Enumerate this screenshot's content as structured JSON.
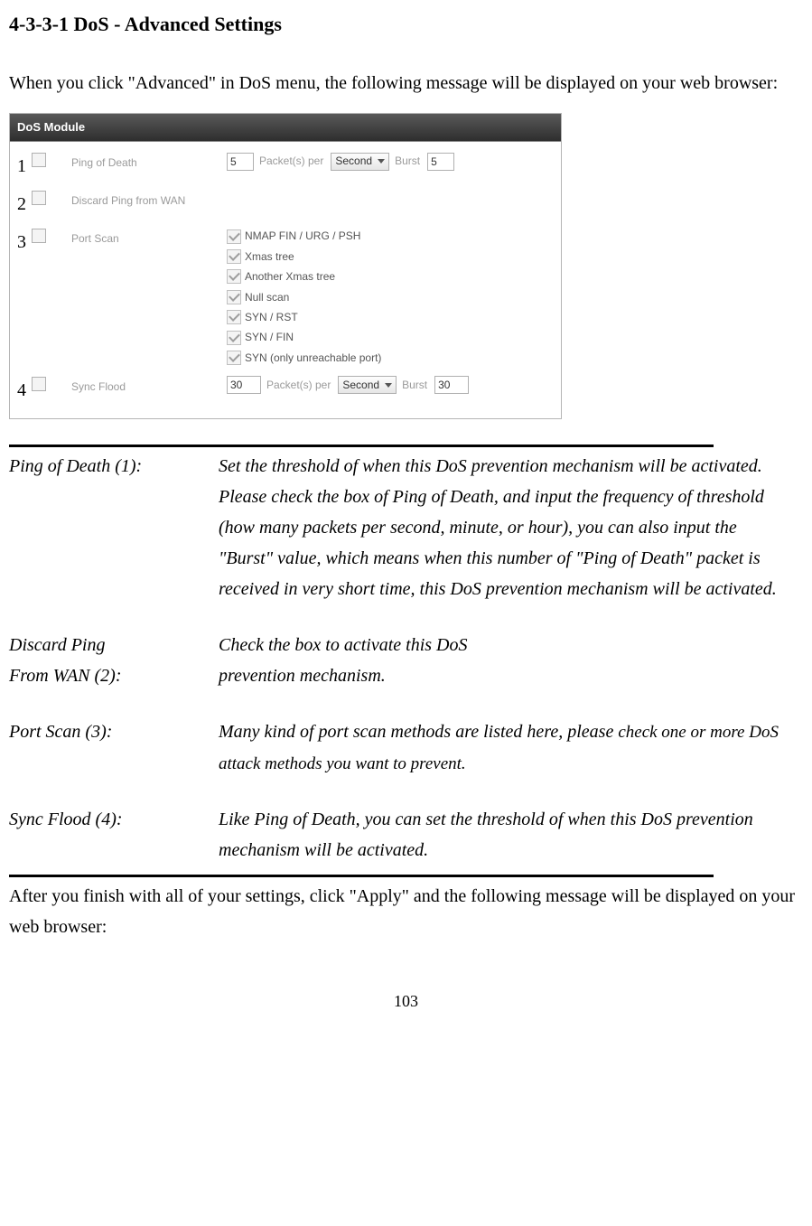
{
  "heading": "4-3-3-1 DoS - Advanced Settings",
  "intro": "When you click \"Advanced\" in DoS menu, the following message will be displayed on your web browser:",
  "screenshot": {
    "title": "DoS Module",
    "rows": {
      "1": {
        "label": "Ping of Death",
        "packets_value": "5",
        "packets_per_label": "Packet(s) per",
        "select_value": "Second",
        "burst_label": "Burst",
        "burst_value": "5"
      },
      "2": {
        "label": "Discard Ping from WAN"
      },
      "3": {
        "label": "Port Scan",
        "options": [
          "NMAP FIN / URG / PSH",
          "Xmas tree",
          "Another Xmas tree",
          "Null scan",
          "SYN / RST",
          "SYN / FIN",
          "SYN (only unreachable port)"
        ]
      },
      "4": {
        "label": "Sync Flood",
        "packets_value": "30",
        "packets_per_label": "Packet(s) per",
        "select_value": "Second",
        "burst_label": "Burst",
        "burst_value": "30"
      }
    }
  },
  "definitions": {
    "d1": {
      "term": "Ping of Death (1):",
      "desc": "Set the threshold of when this DoS prevention mechanism will be activated. Please check the box of Ping of Death, and input the frequency of threshold (how many packets per second, minute, or hour), you can also input the \"Burst\" value, which means when this number of \"Ping of Death\" packet is received in very short time, this DoS prevention mechanism will be activated."
    },
    "d2": {
      "term1": "Discard Ping",
      "term2": "From WAN (2):",
      "desc1": "Check the box to activate this DoS",
      "desc2": "prevention mechanism."
    },
    "d3": {
      "term": "Port Scan (3):",
      "desc_a": "Many kind of port scan methods are listed here, please ",
      "desc_b": "check one or more DoS attack methods you want to prevent."
    },
    "d4": {
      "term": "Sync Flood (4):",
      "desc": "Like Ping of Death, you can set the threshold of when this DoS prevention mechanism will be activated."
    }
  },
  "outro": "After you finish with all of your settings, click \"Apply\" and the following message will be displayed on your web browser:",
  "page_number": "103"
}
